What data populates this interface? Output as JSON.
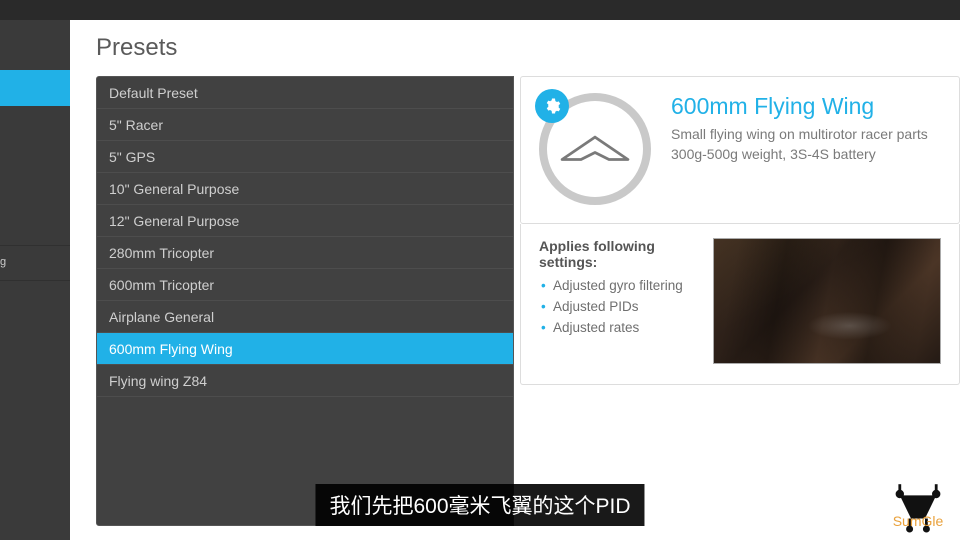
{
  "page_title": "Presets",
  "sidebar_tail": "g",
  "presets": [
    {
      "label": "Default Preset"
    },
    {
      "label": "5\" Racer"
    },
    {
      "label": "5\" GPS"
    },
    {
      "label": "10\" General Purpose"
    },
    {
      "label": "12\" General Purpose"
    },
    {
      "label": "280mm Tricopter"
    },
    {
      "label": "600mm Tricopter"
    },
    {
      "label": "Airplane General"
    },
    {
      "label": "600mm Flying Wing"
    },
    {
      "label": "Flying wing Z84"
    }
  ],
  "selected_index": 8,
  "detail": {
    "title": "600mm Flying Wing",
    "desc_line1": "Small flying wing on multirotor racer parts",
    "desc_line2": "300g-500g weight, 3S-4S battery",
    "applies_heading": "Applies following settings:",
    "applies": [
      "Adjusted gyro filtering",
      "Adjusted PIDs",
      "Adjusted rates"
    ]
  },
  "subtitle": "我们先把600毫米飞翼的这个PID",
  "watermark": "SumGle"
}
